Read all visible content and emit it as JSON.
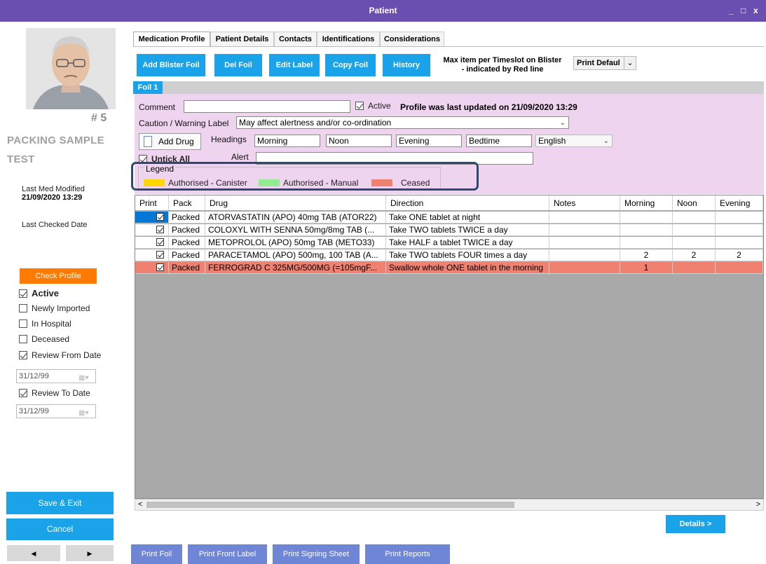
{
  "window": {
    "title": "Patient",
    "minimize": "_",
    "maximize": "□",
    "close": "x"
  },
  "patient": {
    "number": "# 5",
    "name_line1": "PACKING SAMPLE",
    "name_line2": "TEST",
    "last_med_modified_label": "Last Med Modified",
    "last_med_modified_value": "21/09/2020 13:29",
    "last_checked_label": "Last Checked Date",
    "check_profile_label": "Check Profile",
    "flags": {
      "active": "Active",
      "newly_imported": "Newly Imported",
      "in_hospital": "In Hospital",
      "deceased": "Deceased",
      "review_from": "Review From Date",
      "review_to": "Review To Date"
    },
    "review_from_date": "31/12/99",
    "review_to_date": "31/12/99",
    "save_exit": "Save & Exit",
    "cancel": "Cancel",
    "prev": "◀",
    "next": "▶"
  },
  "tabs": [
    "Medication Profile",
    "Patient Details",
    "Contacts",
    "Identifications",
    "Considerations"
  ],
  "toolbar": {
    "add_blister_foil": "Add Blister Foil",
    "del_foil": "Del Foil",
    "edit_label": "Edit Label",
    "copy_foil": "Copy Foil",
    "history": "History",
    "max_item_line1": "Max item per Timeslot on Blister",
    "max_item_line2": "- indicated by Red line",
    "print_default": "Print Defaul"
  },
  "foil": {
    "tab": "Foil 1",
    "comment_label": "Comment",
    "active_label": "Active",
    "updated": "Profile was last updated on 21/09/2020 13:29",
    "caution_label": "Caution / Warning Label",
    "caution_value": "May affect alertness and/or co-ordination",
    "add_drug": "Add Drug",
    "headings_label": "Headings",
    "headings": [
      "Morning",
      "Noon",
      "Evening",
      "Bedtime"
    ],
    "language": "English",
    "untick_all": "Untick All",
    "alert_label": "Alert",
    "legend_title": "Legend",
    "legend": [
      {
        "label": "Authorised - Canister",
        "color": "#ffd700"
      },
      {
        "label": "Authorised - Manual",
        "color": "#90ee90"
      },
      {
        "label": "Ceased",
        "color": "#f08070"
      }
    ]
  },
  "table": {
    "columns": [
      "Print",
      "Pack",
      "Drug",
      "Direction",
      "Notes",
      "Morning",
      "Noon",
      "Evening"
    ],
    "rows": [
      {
        "pack": "Packed",
        "drug": "ATORVASTATIN (APO) 40mg TAB (ATOR22)",
        "direction": "Take ONE tablet at night",
        "notes": "",
        "morning": "",
        "noon": "",
        "evening": ""
      },
      {
        "pack": "Packed",
        "drug": "COLOXYL WITH SENNA 50mg/8mg TAB (...",
        "direction": "Take TWO tablets TWICE a day",
        "notes": "",
        "morning": "",
        "noon": "",
        "evening": ""
      },
      {
        "pack": "Packed",
        "drug": "METOPROLOL (APO) 50mg TAB (METO33)",
        "direction": "Take HALF a tablet TWICE a day",
        "notes": "",
        "morning": "",
        "noon": "",
        "evening": ""
      },
      {
        "pack": "Packed",
        "drug": "PARACETAMOL (APO) 500mg, 100 TAB (A...",
        "direction": "Take TWO tablets FOUR times a day",
        "notes": "",
        "morning": "2",
        "noon": "2",
        "evening": "2"
      },
      {
        "pack": "Packed",
        "drug": "FERROGRAD C 325MG/500MG (=105mgF...",
        "direction": "Swallow whole ONE tablet in the morning",
        "notes": "",
        "morning": "1",
        "noon": "",
        "evening": ""
      }
    ]
  },
  "details_button": "Details >",
  "bottom_buttons": [
    "Print Foil",
    "Print Front Label",
    "Print Signing Sheet",
    "Print Reports"
  ],
  "colors": {
    "titlebar": "#6a4fb0",
    "accent_blue": "#1aa3e8",
    "orange": "#ff7a00",
    "ceased": "#f08070",
    "foil_panel": "#eed4ef"
  }
}
